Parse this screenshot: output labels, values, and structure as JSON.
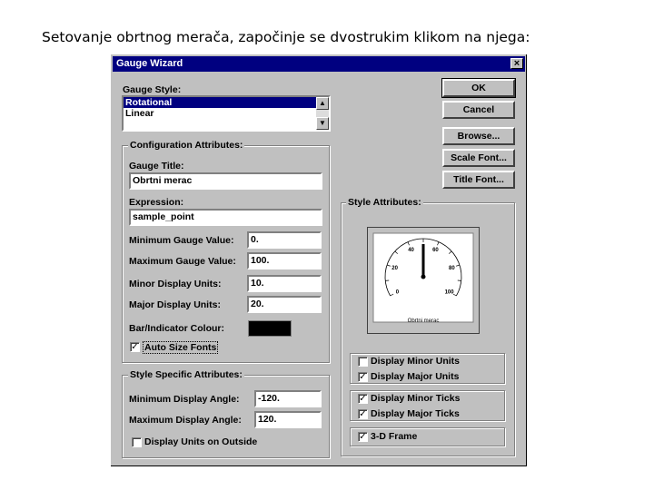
{
  "caption": "Setovanje obrtnog merača, započinje se dvostrukim klikom na njega:",
  "dialog": {
    "title": "Gauge Wizard",
    "close_glyph": "×"
  },
  "gauge_style": {
    "label": "Gauge Style:",
    "options": [
      "Rotational",
      "Linear"
    ],
    "selected": "Rotational"
  },
  "buttons": {
    "ok": "OK",
    "cancel": "Cancel",
    "browse": "Browse...",
    "scale_font": "Scale Font...",
    "title_font": "Title Font..."
  },
  "config": {
    "group_title": "Configuration Attributes:",
    "gauge_title_label": "Gauge Title:",
    "gauge_title_value": "Obrtni merac",
    "expression_label": "Expression:",
    "expression_value": "sample_point",
    "min_value_label": "Minimum Gauge Value:",
    "min_value": "0.",
    "max_value_label": "Maximum Gauge Value:",
    "max_value": "100.",
    "minor_units_label": "Minor Display Units:",
    "minor_units": "10.",
    "major_units_label": "Major Display Units:",
    "major_units": "20.",
    "colour_label": "Bar/Indicator Colour:",
    "colour": "#000000",
    "auto_size_label": "Auto Size Fonts",
    "auto_size_checked": true
  },
  "style_specific": {
    "group_title": "Style Specific Attributes:",
    "min_angle_label": "Minimum Display Angle:",
    "min_angle": "-120.",
    "max_angle_label": "Maximum Display Angle:",
    "max_angle": "120.",
    "units_outside_label": "Display Units on Outside",
    "units_outside_checked": false
  },
  "style_attrs": {
    "group_title": "Style Attributes:",
    "preview": {
      "ticks": [
        "0",
        "20",
        "40",
        "60",
        "80",
        "100"
      ],
      "caption": "Obrtni merac"
    },
    "display_minor_units_label": "Display Minor Units",
    "display_minor_units": false,
    "display_major_units_label": "Display Major Units",
    "display_major_units": true,
    "display_minor_ticks_label": "Display Minor Ticks",
    "display_minor_ticks": true,
    "display_major_ticks_label": "Display Major Ticks",
    "display_major_ticks": true,
    "frame_3d_label": "3-D Frame",
    "frame_3d": true
  },
  "check_glyph": "✓"
}
